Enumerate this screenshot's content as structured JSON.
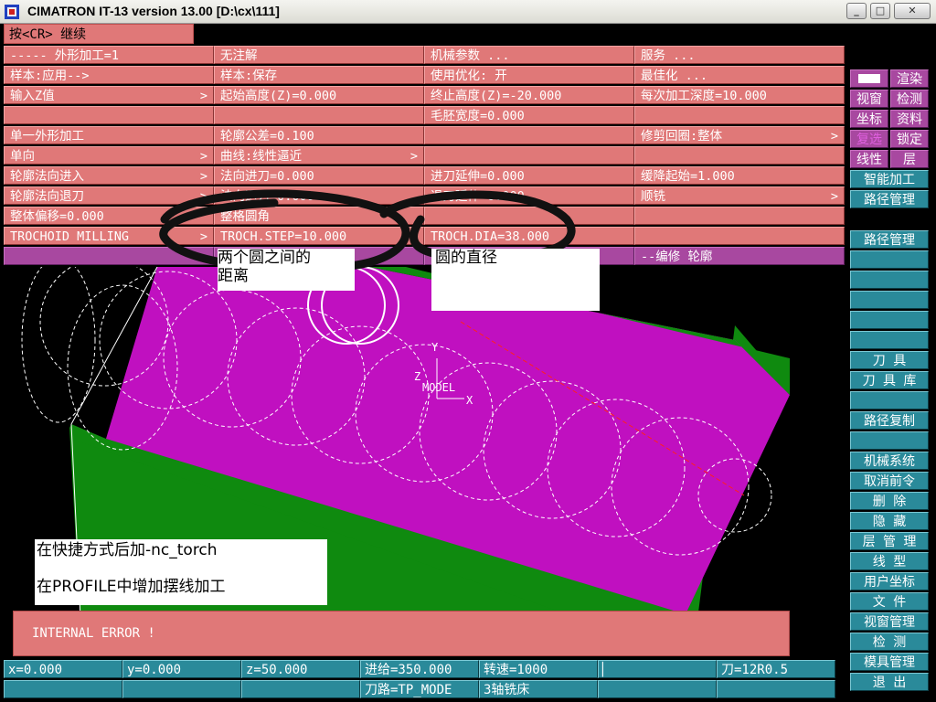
{
  "window": {
    "title": "CIMATRON IT-13 version 13.00 [D:\\cx\\111]"
  },
  "prompt": "按<CR> 继续",
  "menu": {
    "col1": [
      "-----      外形加工=1",
      "样本:应用-->",
      "输入Z值",
      "",
      "单一外形加工",
      "单向",
      "轮廓法向进入",
      "轮廓法向退刀",
      "整体偏移=0.000",
      "TROCHOID MILLING"
    ],
    "col2": [
      "无注解",
      "样本:保存",
      "起始高度(Z)=0.000",
      "",
      "轮廓公差=0.100",
      "曲线:线性逼近",
      "法向进刀=0.000",
      "法向退刀=0.000",
      "整格圆角",
      "TROCH.STEP=10.000"
    ],
    "col3": [
      "机械参数 ...",
      "使用优化: 开",
      "终止高度(Z)=-20.000",
      "毛胚宽度=0.000",
      "",
      "",
      "进刀延伸=0.000",
      "退刀延伸=0.000",
      "",
      "TROCH.DIA=38.000"
    ],
    "col4": [
      "服务 ...",
      "最佳化 ...",
      "每次加工深度=10.000",
      "",
      "修剪回圈:整体",
      "",
      "缓降起始=1.000",
      "顺铣",
      "",
      ""
    ],
    "bar_right": "--编修 轮廓"
  },
  "sidebar_top": {
    "row0_right": "渲染",
    "pairs": [
      [
        "视窗",
        "检测"
      ],
      [
        "坐标",
        "资料"
      ],
      [
        "复选",
        "锁定"
      ],
      [
        "线性",
        "层"
      ]
    ],
    "full": [
      "智能加工",
      "路径管理"
    ]
  },
  "sidebar_main": [
    "路径管理",
    "",
    "",
    "",
    "",
    "",
    "刀 具",
    "刀 具 库",
    "",
    "路径复制",
    "",
    "机械系统",
    "取消前令",
    "删 除",
    "隐 藏",
    "层 管 理",
    "线 型",
    "用户坐标",
    "文 件",
    "视窗管理",
    "检 测",
    "模具管理",
    "退 出"
  ],
  "notes": {
    "step": "两个圆之间的\n距离",
    "dia": "圆的直径",
    "bottom1": "在快捷方式后加-nc_torch",
    "bottom2": "在PROFILE中增加摆线加工"
  },
  "viewport": {
    "model_label": "MODEL",
    "axis_x": "X",
    "axis_y": "Y",
    "axis_z": "Z"
  },
  "error": "INTERNAL ERROR !",
  "status": {
    "x": "x=0.000",
    "y": "y=0.000",
    "z": "z=50.000",
    "feed": "进给=350.000",
    "speed": "转速=1000",
    "tool": "刀=12R0.5",
    "path": "刀路=TP_MODE",
    "machine": "3轴铣床"
  },
  "colors": {
    "menu": "#e07878",
    "side": "#2a8a9a",
    "part_top": "#c010c0",
    "part_side": "#118a11"
  }
}
